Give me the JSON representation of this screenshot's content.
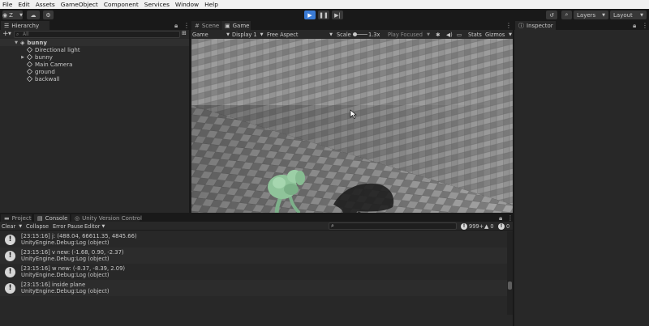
{
  "menu": [
    "File",
    "Edit",
    "Assets",
    "GameObject",
    "Component",
    "Services",
    "Window",
    "Help"
  ],
  "toolbar": {
    "account_label": "Z",
    "layers_label": "Layers",
    "layout_label": "Layout"
  },
  "hierarchy": {
    "tab": "Hierarchy",
    "add_label": "+",
    "search_placeholder": "All",
    "scene": "bunny",
    "items": [
      "Directional light",
      "bunny",
      "Main Camera",
      "ground",
      "backwall"
    ]
  },
  "game": {
    "tabs": [
      "Scene",
      "Game"
    ],
    "display_mode": "Game",
    "display": "Display 1",
    "aspect": "Free Aspect",
    "scale_label": "Scale",
    "scale_value": "1.3x",
    "play_focused": "Play Focused",
    "stats": "Stats",
    "gizmos": "Gizmos"
  },
  "inspector": {
    "tab": "Inspector"
  },
  "bottom": {
    "tabs": [
      "Project",
      "Console",
      "Unity Version Control"
    ],
    "clear": "Clear",
    "collapse": "Collapse",
    "error_pause": "Error Pause",
    "editor": "Editor",
    "count_logs": "999+",
    "count_warnings": "0",
    "count_errors": "0",
    "logs": [
      {
        "line1": "[23:15:16] j: (488.04, 66611.35, 4845.66)",
        "line2": "UnityEngine.Debug:Log (object)"
      },
      {
        "line1": "[23:15:16] v new: (-1.68, 0.90, -2.37)",
        "line2": "UnityEngine.Debug:Log (object)"
      },
      {
        "line1": "[23:15:16] w new: (-8.37, -8.39, 2.09)",
        "line2": "UnityEngine.Debug:Log (object)"
      },
      {
        "line1": "[23:15:16] inside plane",
        "line2": "UnityEngine.Debug:Log (object)"
      }
    ]
  },
  "colors": {
    "play_accent": "#3a7bd5",
    "panel_bg": "#282828",
    "bunny_green": "#8fc49a"
  }
}
